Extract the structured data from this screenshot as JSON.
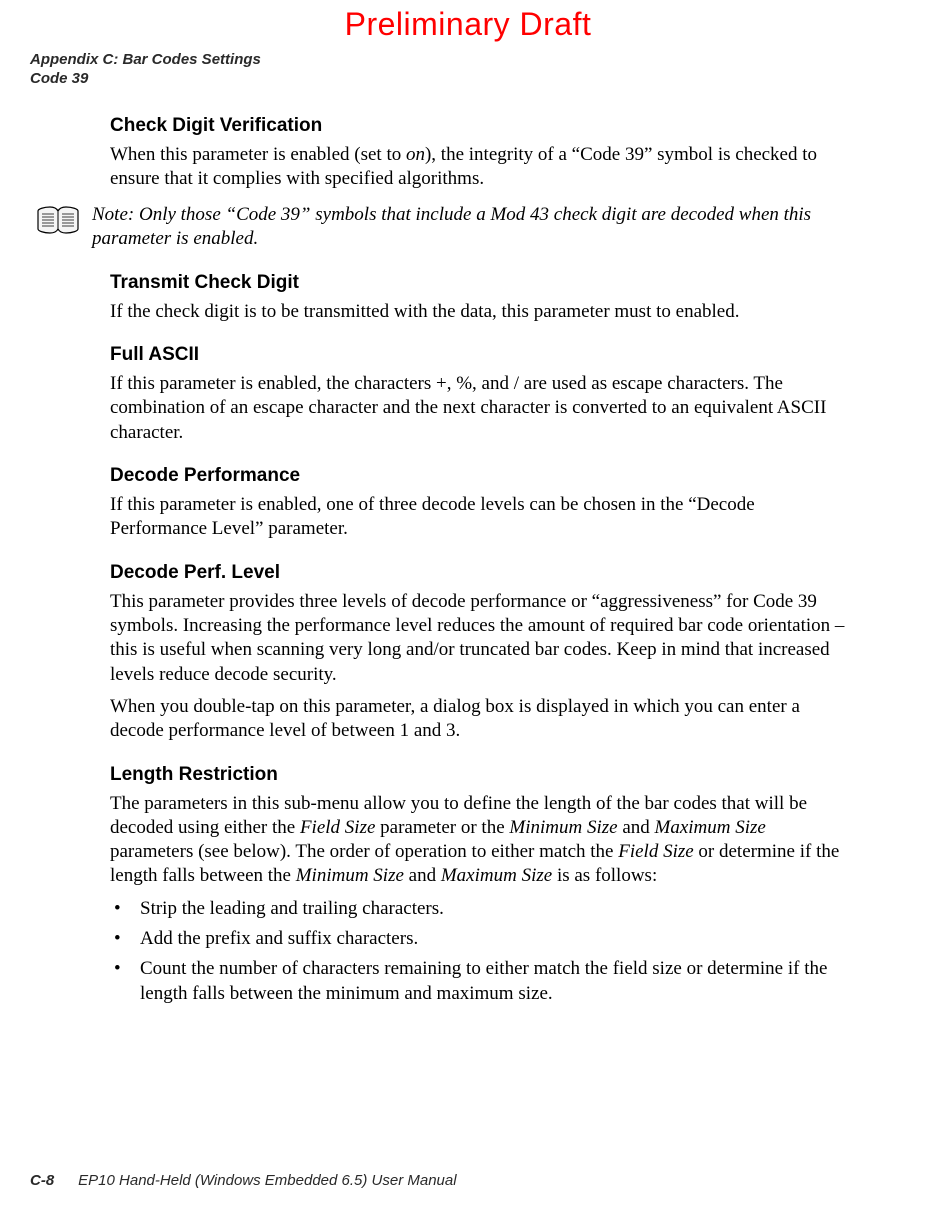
{
  "banner": "Preliminary Draft",
  "header": {
    "line1": "Appendix C: Bar Codes Settings",
    "line2": "Code 39"
  },
  "sections": {
    "checkDigitVerification": {
      "title": "Check Digit Verification",
      "body_pre": "When this parameter is enabled (set to ",
      "body_em": "on",
      "body_post": "), the integrity of a “Code 39” symbol is checked to ensure that it complies with specified algorithms."
    },
    "note": {
      "label": "Note:",
      "text": " Only those “Code 39” symbols that include a Mod 43 check digit are decoded when this parameter is enabled."
    },
    "transmitCheckDigit": {
      "title": "Transmit Check Digit",
      "body": "If the check digit is to be transmitted with the data, this parameter must to enabled."
    },
    "fullAscii": {
      "title": "Full ASCII",
      "body": "If this parameter is enabled, the characters +, %, and / are used as escape characters. The combination of an escape character and the next character is converted to an equivalent ASCII character."
    },
    "decodePerformance": {
      "title": "Decode Performance",
      "body": "If this parameter is enabled, one of three decode levels can be chosen in the “Decode Performance Level” parameter."
    },
    "decodePerfLevel": {
      "title": "Decode Perf. Level",
      "body1": "This parameter provides three levels of decode performance or “aggressiveness” for Code 39 symbols. Increasing the performance level reduces the amount of required bar code orientation – this is useful when scanning very long and/or truncated bar codes. Keep in mind that increased levels reduce decode security.",
      "body2": "When you double-tap on this parameter, a dialog box is displayed in which you can enter a decode performance level of between 1 and 3."
    },
    "lengthRestriction": {
      "title": "Length Restriction",
      "intro_parts": {
        "p1": "The parameters in this sub-menu allow you to define the length of the bar codes that will be decoded using either the ",
        "i1": "Field Size",
        "p2": " parameter or the ",
        "i2": "Minimum Size",
        "p3": " and ",
        "i3": "Maximum Size",
        "p4": " parameters (see below). The order of operation to either match the ",
        "i4": "Field Size",
        "p5": " or determine if the length falls between the ",
        "i5": "Minimum Size",
        "p6": " and ",
        "i6": "Maximum Size",
        "p7": " is as follows:"
      },
      "bullets": [
        "Strip the leading and trailing characters.",
        "Add the prefix and suffix characters.",
        "Count the number of characters remaining to either match the field size or determine if the length falls between the minimum and maximum size."
      ]
    }
  },
  "footer": {
    "pageNo": "C-8",
    "manual": "EP10 Hand-Held (Windows Embedded 6.5) User Manual"
  }
}
